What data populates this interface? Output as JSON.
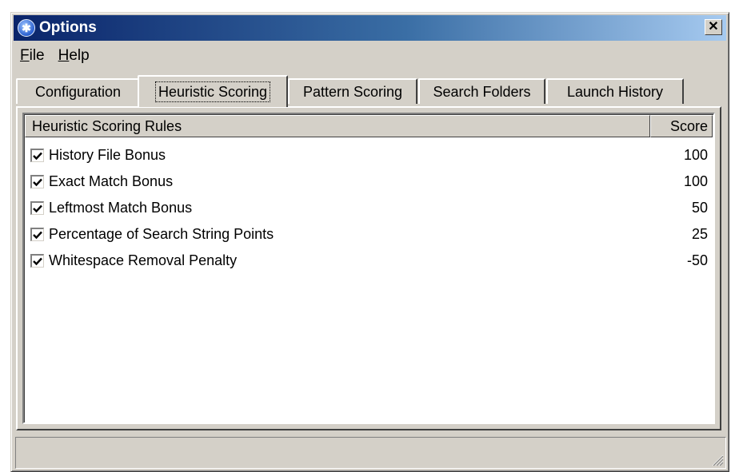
{
  "window": {
    "title": "Options",
    "close_label": "✕",
    "app_icon": "running-man-icon",
    "app_icon_glyph": "✱"
  },
  "menubar": {
    "items": [
      {
        "accel": "F",
        "rest": "ile"
      },
      {
        "accel": "H",
        "rest": "elp"
      }
    ]
  },
  "tabs": [
    {
      "label": "Configuration",
      "active": false
    },
    {
      "label": "Heuristic Scoring",
      "active": true
    },
    {
      "label": "Pattern Scoring",
      "active": false
    },
    {
      "label": "Search Folders",
      "active": false
    },
    {
      "label": "Launch History",
      "active": false
    }
  ],
  "list": {
    "columns": {
      "rules": "Heuristic Scoring Rules",
      "score": "Score"
    },
    "rows": [
      {
        "label": "History File Bonus",
        "score": "100",
        "checked": true
      },
      {
        "label": "Exact Match Bonus",
        "score": "100",
        "checked": true
      },
      {
        "label": "Leftmost Match Bonus",
        "score": "50",
        "checked": true
      },
      {
        "label": "Percentage of Search String Points",
        "score": "25",
        "checked": true
      },
      {
        "label": "Whitespace Removal Penalty",
        "score": "-50",
        "checked": true
      }
    ]
  },
  "statusbar": {
    "text": ""
  }
}
